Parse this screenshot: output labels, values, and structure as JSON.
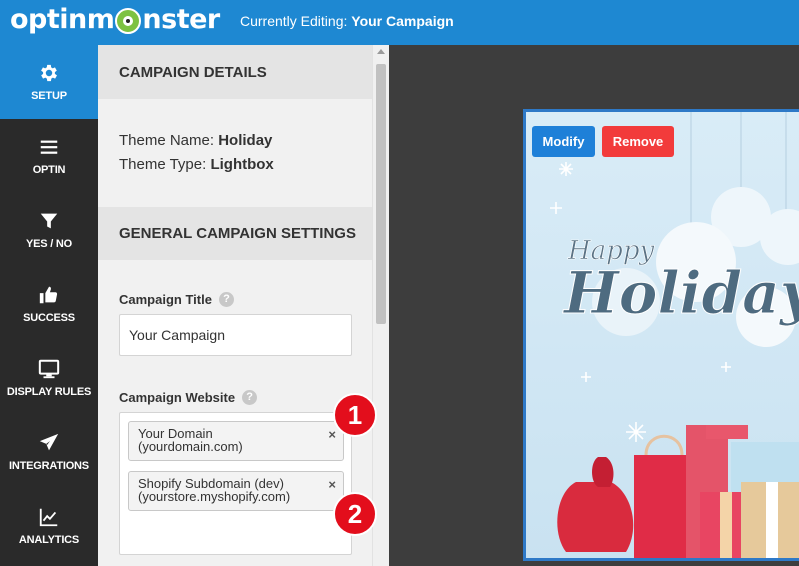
{
  "header": {
    "logo_text_left": "optinm",
    "logo_text_right": "nster",
    "editing_label": "Currently Editing:",
    "campaign_name": "Your Campaign"
  },
  "nav": [
    {
      "label": "SETUP",
      "icon": "gear-icon",
      "active": true
    },
    {
      "label": "OPTIN",
      "icon": "menu-lines-icon",
      "active": false
    },
    {
      "label": "YES / NO",
      "icon": "funnel-icon",
      "active": false
    },
    {
      "label": "SUCCESS",
      "icon": "thumbs-up-icon",
      "active": false
    },
    {
      "label": "DISPLAY RULES",
      "icon": "monitor-icon",
      "active": false
    },
    {
      "label": "INTEGRATIONS",
      "icon": "paper-plane-icon",
      "active": false
    },
    {
      "label": "ANALYTICS",
      "icon": "line-chart-icon",
      "active": false
    }
  ],
  "panel": {
    "campaign_details": {
      "title": "CAMPAIGN DETAILS",
      "theme_name_label": "Theme Name:",
      "theme_name": "Holiday",
      "theme_type_label": "Theme Type:",
      "theme_type": "Lightbox"
    },
    "general": {
      "title": "GENERAL CAMPAIGN SETTINGS",
      "campaign_title_label": "Campaign Title",
      "campaign_title_value": "Your Campaign",
      "campaign_website_label": "Campaign Website",
      "help_icon_text": "?",
      "websites": [
        {
          "line1": "Your Domain",
          "line2": "(yourdomain.com)"
        },
        {
          "line1": "Shopify Subdomain (dev)",
          "line2": "(yourstore.myshopify.com)"
        }
      ],
      "remove_glyph": "×"
    }
  },
  "badges": [
    "1",
    "2"
  ],
  "preview": {
    "modify_label": "Modify",
    "remove_label": "Remove",
    "happy_text": "Happy",
    "holiday_text": "Holiday"
  },
  "colors": {
    "brand_blue": "#1e88d2",
    "nav_bg": "#2a2a2a",
    "badge_red": "#e30e1c",
    "remove_red": "#f23b3b"
  }
}
